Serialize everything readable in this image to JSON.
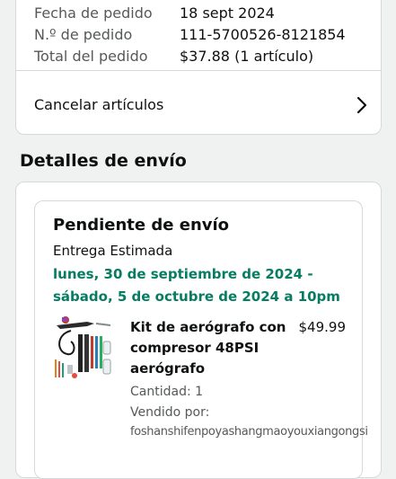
{
  "order_summary": {
    "rows": [
      {
        "label": "Fecha de pedido",
        "value": "18 sept 2024"
      },
      {
        "label": "N.º de pedido",
        "value": "111-5700526-8121854"
      },
      {
        "label": "Total del pedido",
        "value": "$37.88 (1 artículo)"
      }
    ],
    "cancel_label": "Cancelar artículos"
  },
  "shipping": {
    "section_title": "Detalles de envío",
    "status": "Pendiente de envío",
    "estimate_label": "Entrega Estimada",
    "estimate_range": "lunes, 30 de septiembre de 2024 - sábado, 5 de octubre de 2024 a 10pm",
    "item": {
      "title": "Kit de aerógrafo con compresor 48PSI aerógrafo",
      "price": "$49.99",
      "quantity": "Cantidad: 1",
      "seller_label": "Vendido por:",
      "seller_name": "foshanshifenpoyashangmaoyouxiangongsi"
    }
  },
  "colors": {
    "delivery_green": "#067d62",
    "secondary_text": "#565959",
    "border": "#d5d9d9"
  },
  "icons": {
    "cancel_row": "chevron-right-icon"
  }
}
